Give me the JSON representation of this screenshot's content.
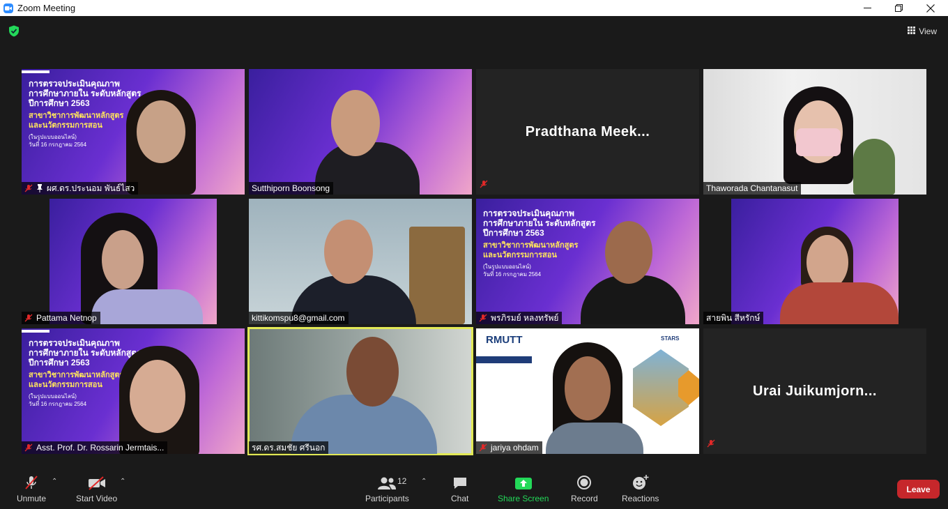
{
  "window": {
    "title": "Zoom Meeting"
  },
  "topbar": {
    "view_label": "View"
  },
  "slide": {
    "line1": "การตรวจประเมินคุณภาพ",
    "line2": "การศึกษาภายใน ระดับหลักสูตร",
    "line3": "ปีการศึกษา 2563",
    "line4": "สาขาวิชาการพัฒนาหลักสูตร",
    "line5": "และนวัตกรรมการสอน",
    "line6": "(ในรูปแบบออนไลน์)",
    "line7": "วันที่ 16 กรกฎาคม 2564"
  },
  "tiles": [
    {
      "name": "ผศ.ดร.ประนอม พันธ์ไสว",
      "muted": true,
      "pinned": true,
      "video": "slide"
    },
    {
      "name": "Sutthiporn Boonsong",
      "muted": false,
      "video": "slide"
    },
    {
      "name": "Pradthana Meek...",
      "muted": true,
      "video": "off"
    },
    {
      "name": "Thaworada Chantanasut",
      "muted": false,
      "video": "room"
    },
    {
      "name": "Pattama Netnop",
      "muted": true,
      "video": "slide"
    },
    {
      "name": "kittikomspu8@gmail.com",
      "muted": false,
      "video": "room"
    },
    {
      "name": "พรภิรมย์ หลงทรัพย์",
      "muted": true,
      "video": "slide"
    },
    {
      "name": "สายพิน สีหรักษ์",
      "muted": false,
      "video": "slide"
    },
    {
      "name": "Asst. Prof. Dr. Rossarin  Jermtais...",
      "muted": true,
      "video": "slide"
    },
    {
      "name": "รศ.ดร.สมชัย ศรีนอก",
      "muted": false,
      "video": "room",
      "active_speaker": true
    },
    {
      "name": "jariya ohdam",
      "muted": true,
      "video": "rmutt"
    },
    {
      "name": "Urai  Juikumjorn...",
      "muted": true,
      "video": "off"
    }
  ],
  "rmutt": {
    "logo": "RMUTT",
    "stars": "STARS"
  },
  "toolbar": {
    "unmute": "Unmute",
    "start_video": "Start Video",
    "participants": "Participants",
    "participants_count": "12",
    "chat": "Chat",
    "share_screen": "Share Screen",
    "record": "Record",
    "reactions": "Reactions",
    "leave": "Leave"
  },
  "colors": {
    "accent_green": "#23d959",
    "leave_red": "#c6272b",
    "active_speaker": "#e2e956",
    "muted_red": "#e02828"
  }
}
